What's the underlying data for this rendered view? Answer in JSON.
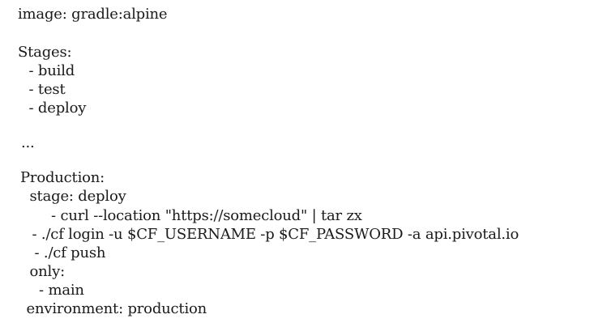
{
  "document": {
    "lines": [
      "image: gradle:alpine",
      "Stages:",
      " - build",
      " - test",
      " - deploy",
      "...",
      "Production:",
      " stage: deploy",
      "  - curl --location \"https://somecloud\" | tar zx",
      " - ./cf login -u $CF_USERNAME -p $CF_PASSWORD -a api.pivotal.io",
      " - ./cf push",
      " only:",
      "  - main",
      " environment: production"
    ]
  }
}
